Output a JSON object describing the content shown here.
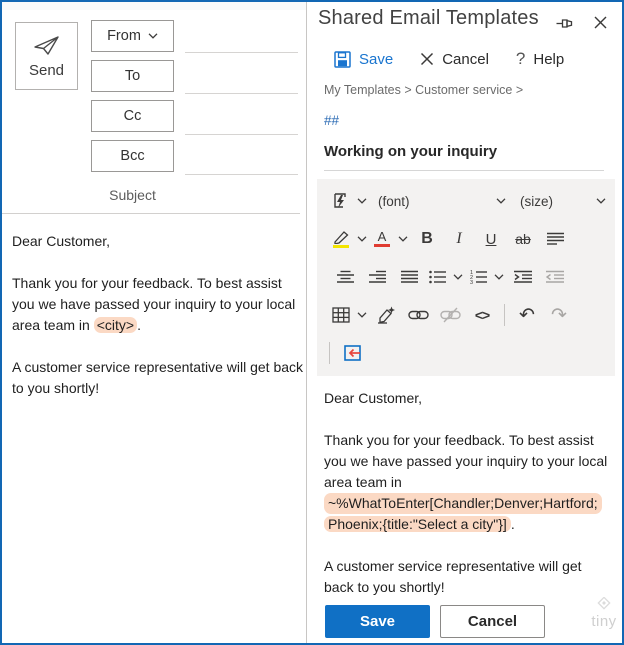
{
  "colors": {
    "accent_blue": "#1267b4",
    "save_blue": "#1070c5",
    "highlight_peach": "#fbd9c4",
    "toolbar_bg": "#f3f2f1"
  },
  "compose": {
    "send": "Send",
    "from": "From",
    "to": "To",
    "cc": "Cc",
    "bcc": "Bcc",
    "subject": "Subject",
    "body": {
      "greeting": "Dear Customer,",
      "para1_before": "Thank you for your feedback. To best assist you we have passed your inquiry to your local area team in ",
      "placeholder": "<city>",
      "para1_after": ".",
      "para2": "A customer service representative will get back to you shortly!"
    }
  },
  "panel": {
    "title": "Shared Email Templates",
    "commands": {
      "save": "Save",
      "cancel": "Cancel",
      "help": "Help",
      "help_glyph": "?"
    },
    "breadcrumb": "My Templates > Customer service >",
    "shortcut": "##",
    "template_name": "Working on your inquiry",
    "toolbar": {
      "font": "(font)",
      "size": "(size)",
      "bold": "B",
      "italic": "I",
      "underline": "U",
      "strike": "ab",
      "color_letter": "A",
      "code": "<>",
      "undo": "↶",
      "redo": "↷"
    },
    "editor": {
      "greeting": "Dear Customer,",
      "para1_before": "Thank you for your feedback. To best assist you we have passed your inquiry to your local area team in ",
      "macro_line1": "~%WhatToEnter[Chandler;Denver;Hartford;",
      "macro_line2": "Phoenix;{title:\"Select a city\"}]",
      "para1_after": ".",
      "para2": "A customer service representative will get back to you shortly!"
    },
    "footer": {
      "save": "Save",
      "cancel": "Cancel"
    },
    "watermark": "tiny"
  }
}
